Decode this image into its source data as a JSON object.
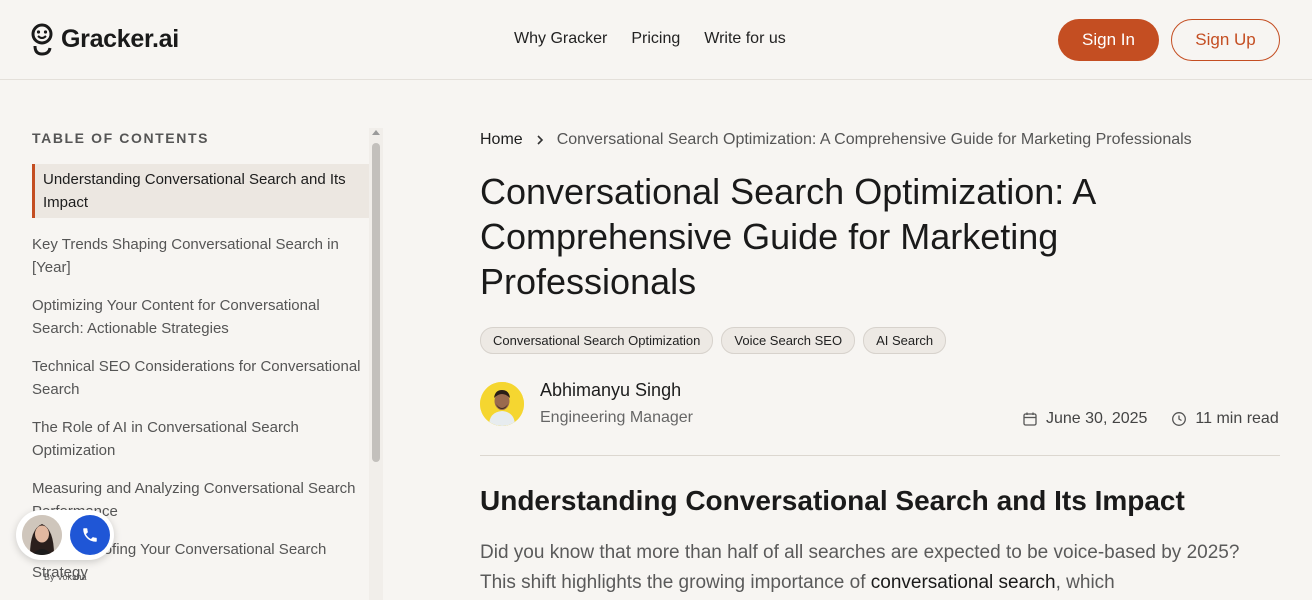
{
  "header": {
    "logo_text": "Gracker.ai",
    "nav": [
      "Why Gracker",
      "Pricing",
      "Write for us"
    ],
    "sign_in": "Sign In",
    "sign_up": "Sign Up",
    "accent_color": "#c44e22"
  },
  "toc": {
    "title": "TABLE OF CONTENTS",
    "items": [
      "Understanding Conversational Search and Its Impact",
      "Key Trends Shaping Conversational Search in [Year]",
      "Optimizing Your Content for Conversational Search: Actionable Strategies",
      "Technical SEO Considerations for Conversational Search",
      "The Role of AI in Conversational Search Optimization",
      "Measuring and Analyzing Conversational Search Performance",
      "Future-Proofing Your Conversational Search Strategy"
    ]
  },
  "voice_widget": {
    "by_label": "By Voksha",
    "call_color": "#1f56d6"
  },
  "breadcrumb": {
    "home": "Home",
    "current": "Conversational Search Optimization: A Comprehensive Guide for Marketing Professionals"
  },
  "article": {
    "title": "Conversational Search Optimization: A Comprehensive Guide for Marketing Professionals",
    "tags": [
      "Conversational Search Optimization",
      "Voice Search SEO",
      "AI Search"
    ],
    "author_name": "Abhimanyu Singh",
    "author_role": "Engineering Manager",
    "date": "June 30, 2025",
    "read_time": "11 min read",
    "section_title": "Understanding Conversational Search and Its Impact",
    "body_part1": "Did you know that more than half of all searches are expected to be voice-based by 2025? This shift highlights the growing importance of ",
    "body_bold": "conversational search",
    "body_part2": ", which"
  }
}
